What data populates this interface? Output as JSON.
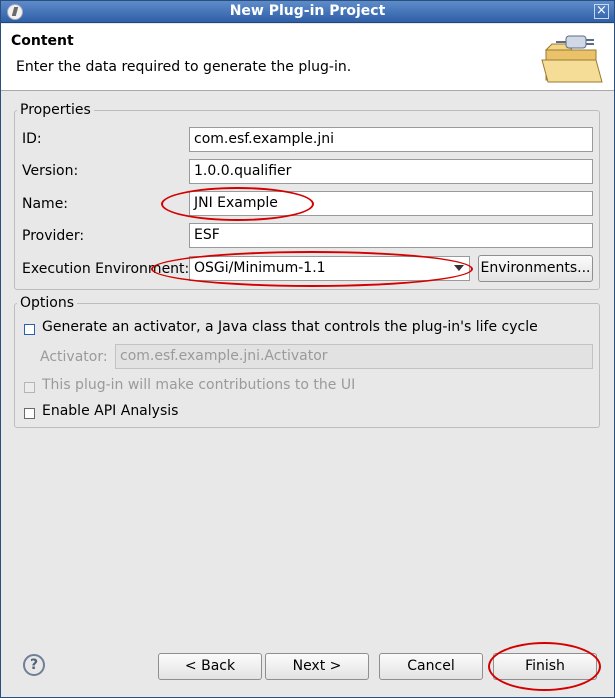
{
  "window": {
    "title": "New Plug-in Project"
  },
  "header": {
    "title": "Content",
    "description": "Enter the data required to generate the plug-in.",
    "icon": "wizard-folder-plug-icon"
  },
  "properties": {
    "group_label": "Properties",
    "id": {
      "label": "ID:",
      "value": "com.esf.example.jni"
    },
    "version": {
      "label": "Version:",
      "value": "1.0.0.qualifier"
    },
    "name": {
      "label": "Name:",
      "value": "JNI Example"
    },
    "provider": {
      "label": "Provider:",
      "value": "ESF"
    },
    "execution_environment": {
      "label": "Execution Environment:",
      "value": "OSGi/Minimum-1.1"
    },
    "environments_button": "Environments..."
  },
  "options": {
    "group_label": "Options",
    "generate_activator": {
      "label": "Generate an activator, a Java class that controls the plug-in's life cycle",
      "checked": false
    },
    "activator": {
      "label": "Activator:",
      "value": "com.esf.example.jni.Activator"
    },
    "ui_contributions": {
      "label": "This plug-in will make contributions to the UI",
      "checked": false,
      "enabled": false
    },
    "api_analysis": {
      "label": "Enable API Analysis",
      "checked": false
    }
  },
  "footer": {
    "help_icon": "help-icon",
    "back": "< Back",
    "next": "Next >",
    "cancel": "Cancel",
    "finish": "Finish"
  },
  "annotation_color": "#d40000"
}
